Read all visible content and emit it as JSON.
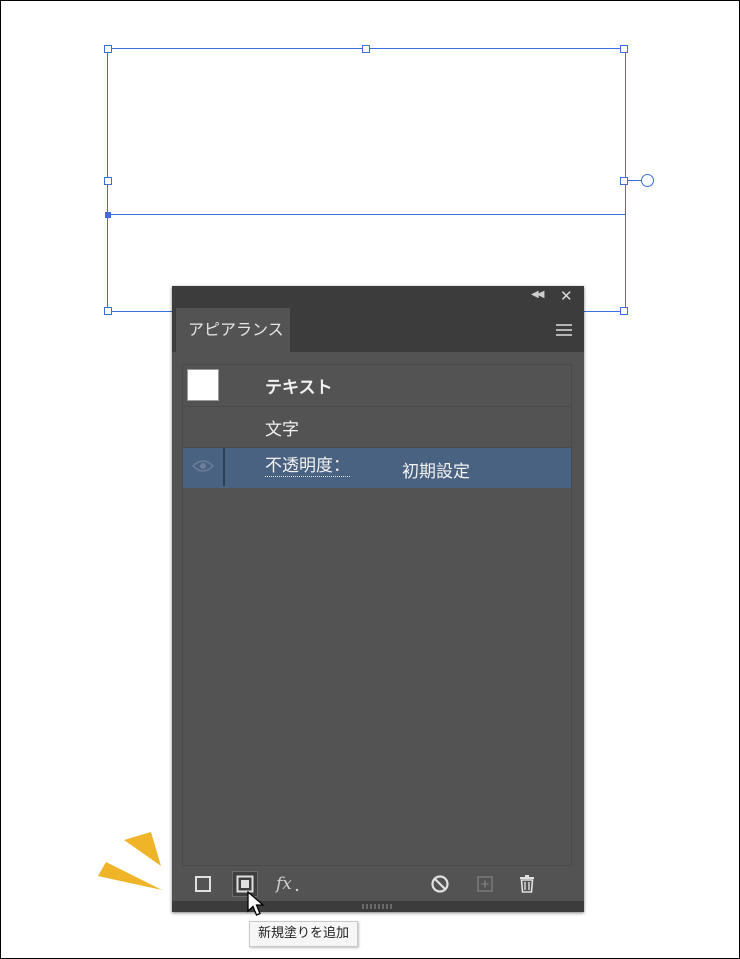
{
  "panel": {
    "tab_label": "アピアランス",
    "rows": [
      {
        "label": "テキスト"
      },
      {
        "label": "文字"
      },
      {
        "label": "不透明度：",
        "value": "初期設定"
      }
    ]
  },
  "toolbar": {
    "tooltip": "新規塗りを追加"
  },
  "icons": {
    "collapse": "double-chevron-left-icon",
    "close": "close-icon",
    "menu": "hamburger-menu-icon",
    "eye": "eye-icon",
    "add_stroke": "add-new-stroke-icon",
    "add_fill": "add-new-fill-icon",
    "fx": "fx-icon",
    "clear": "clear-appearance-icon",
    "duplicate": "duplicate-item-icon",
    "delete": "trash-icon"
  },
  "colors": {
    "selection": "#3b6fd9",
    "panel_bg": "#535353",
    "selected_row": "#4a6282",
    "highlight_burst": "#f0b429"
  }
}
